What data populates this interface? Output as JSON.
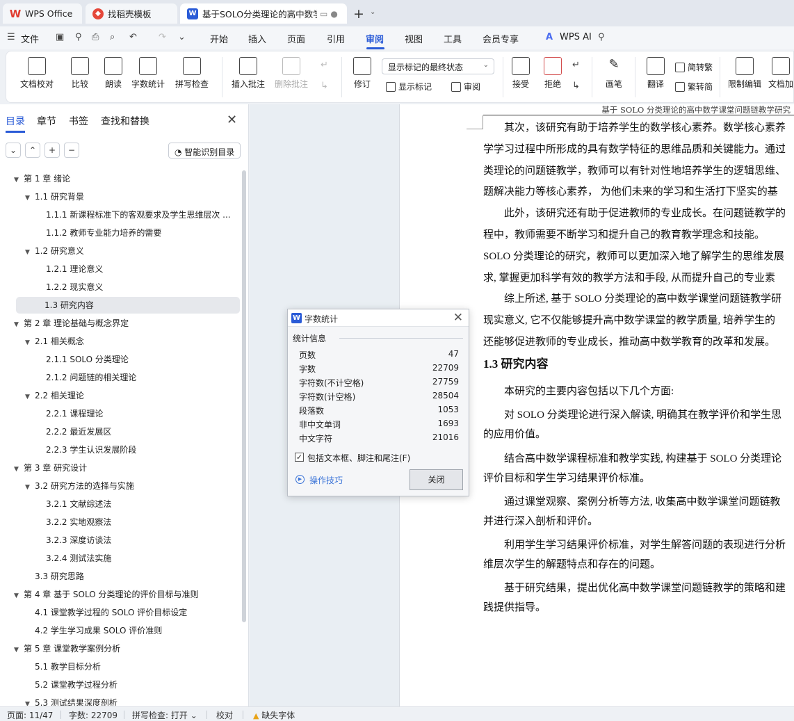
{
  "tabs": {
    "wps": "WPS Office",
    "docer": "找稻壳模板",
    "document": "基于SOLO分类理论的高中数学课堂问题链教学研究"
  },
  "menu": {
    "file": "文件",
    "items": [
      "开始",
      "插入",
      "页面",
      "引用",
      "审阅",
      "视图",
      "工具",
      "会员专享"
    ],
    "active": "审阅",
    "ai": "WPS AI"
  },
  "ribbon": {
    "proofread": "文档校对",
    "compare": "比较",
    "read_aloud": "朗读",
    "word_count": "字数统计",
    "spell_check": "拼写检查",
    "insert_comment": "插入批注",
    "delete_comment": "删除批注",
    "track_changes": "修订",
    "markup_mode": "显示标记的最终状态",
    "show_markup": "显示标记",
    "review": "审阅",
    "accept": "接受",
    "reject": "拒绝",
    "ink": "画笔",
    "translate": "翻译",
    "to_traditional": "简转繁",
    "to_simplified": "繁转简",
    "restrict_editing": "限制编辑",
    "doc_encrypt": "文档加"
  },
  "nav": {
    "tabs": [
      "目录",
      "章节",
      "书签",
      "查找和替换"
    ],
    "smart_toc": "智能识别目录",
    "toc": [
      {
        "level": 0,
        "text": "第 1 章  绪论",
        "expand": true
      },
      {
        "level": 1,
        "text": "1.1  研究背景",
        "expand": true
      },
      {
        "level": 2,
        "text": "1.1.1  新课程标准下的客观要求及学生思维层次 ..."
      },
      {
        "level": 2,
        "text": "1.1.2  教师专业能力培养的需要"
      },
      {
        "level": 1,
        "text": "1.2  研究意义",
        "expand": true
      },
      {
        "level": 2,
        "text": "1.2.1  理论意义"
      },
      {
        "level": 2,
        "text": "1.2.2  现实意义"
      },
      {
        "level": 1,
        "text": "1.3  研究内容",
        "selected": true
      },
      {
        "level": 0,
        "text": "第 2 章  理论基础与概念界定",
        "expand": true
      },
      {
        "level": 1,
        "text": "2.1  相关概念",
        "expand": true
      },
      {
        "level": 2,
        "text": "2.1.1 SOLO 分类理论"
      },
      {
        "level": 2,
        "text": "2.1.2  问题链的相关理论"
      },
      {
        "level": 1,
        "text": "2.2  相关理论",
        "expand": true
      },
      {
        "level": 2,
        "text": "2.2.1  课程理论"
      },
      {
        "level": 2,
        "text": "2.2.2  最近发展区"
      },
      {
        "level": 2,
        "text": "2.2.3  学生认识发展阶段"
      },
      {
        "level": 0,
        "text": "第 3 章  研究设计",
        "expand": true
      },
      {
        "level": 1,
        "text": "3.2  研究方法的选择与实施",
        "expand": true
      },
      {
        "level": 2,
        "text": "3.2.1  文献综述法"
      },
      {
        "level": 2,
        "text": "3.2.2  实地观察法"
      },
      {
        "level": 2,
        "text": "3.2.3  深度访谈法"
      },
      {
        "level": 2,
        "text": "3.2.4  测试法实施"
      },
      {
        "level": 1,
        "text": "3.3  研究思路"
      },
      {
        "level": 0,
        "text": "第 4 章  基于 SOLO 分类理论的评价目标与准则",
        "expand": true
      },
      {
        "level": 1,
        "text": "4.1  课堂教学过程的 SOLO 评价目标设定"
      },
      {
        "level": 1,
        "text": "4.2  学生学习成果 SOLO 评价准则"
      },
      {
        "level": 0,
        "text": "第 5 章  课堂教学案例分析",
        "expand": true
      },
      {
        "level": 1,
        "text": "5.1  教学目标分析"
      },
      {
        "level": 1,
        "text": "5.2  课堂教学过程分析"
      },
      {
        "level": 1,
        "text": "5.3  测试结果深度剖析",
        "expand": true
      }
    ]
  },
  "document": {
    "running_head": "基于 SOLO 分类理论的高中数学课堂问题链教学研究",
    "lines": [
      "　　其次，该研究有助于培养学生的数学核心素养。数学核心素养",
      "学学习过程中所形成的具有数学特征的思维品质和关键能力。通过",
      "类理论的问题链教学，教师可以有针对性地培养学生的逻辑思维、",
      "题解决能力等核心素养， 为他们未来的学习和生活打下坚实的基",
      "　　此外，该研究还有助于促进教师的专业成长。在问题链教学的",
      "程中，教师需要不断学习和提升自己的教育教学理念和技能。",
      "SOLO 分类理论的研究，教师可以更加深入地了解学生的思维发展",
      "求, 掌握更加科学有效的教学方法和手段, 从而提升自己的专业素",
      "　　综上所述, 基于 SOLO 分类理论的高中数学课堂问题链教学研",
      "现实意义, 它不仅能够提升高中数学课堂的教学质量, 培养学生的",
      "还能够促进教师的专业成长，推动高中数学教育的改革和发展。"
    ],
    "heading": "1.3  研究内容",
    "lines2": [
      "　　本研究的主要内容包括以下几个方面:",
      "　　对 SOLO 分类理论进行深入解读, 明确其在教学评价和学生思",
      "的应用价值。",
      "　　结合高中数学课程标准和教学实践, 构建基于 SOLO 分类理论",
      "评价目标和学生学习结果评价标准。",
      "　　通过课堂观察、案例分析等方法, 收集高中数学课堂问题链教",
      "并进行深入剖析和评价。",
      "　　利用学生学习结果评价标准，对学生解答问题的表现进行分析",
      "维层次学生的解题特点和存在的问题。",
      "　　基于研究结果，提出优化高中数学课堂问题链教学的策略和建",
      "践提供指导。"
    ]
  },
  "dialog": {
    "title": "字数统计",
    "group": "统计信息",
    "stats": [
      {
        "label": "页数",
        "value": "47"
      },
      {
        "label": "字数",
        "value": "22709"
      },
      {
        "label": "字符数(不计空格)",
        "value": "27759"
      },
      {
        "label": "字符数(计空格)",
        "value": "28504"
      },
      {
        "label": "段落数",
        "value": "1053"
      },
      {
        "label": "非中文单词",
        "value": "1693"
      },
      {
        "label": "中文字符",
        "value": "21016"
      }
    ],
    "checkbox": "包括文本框、脚注和尾注(F)",
    "tips": "操作技巧",
    "close": "关闭"
  },
  "status": {
    "page": "页面: 11/47",
    "words": "字数: 22709",
    "spell": "拼写检查: 打开",
    "proof": "校对",
    "missing_font": "缺失字体"
  }
}
